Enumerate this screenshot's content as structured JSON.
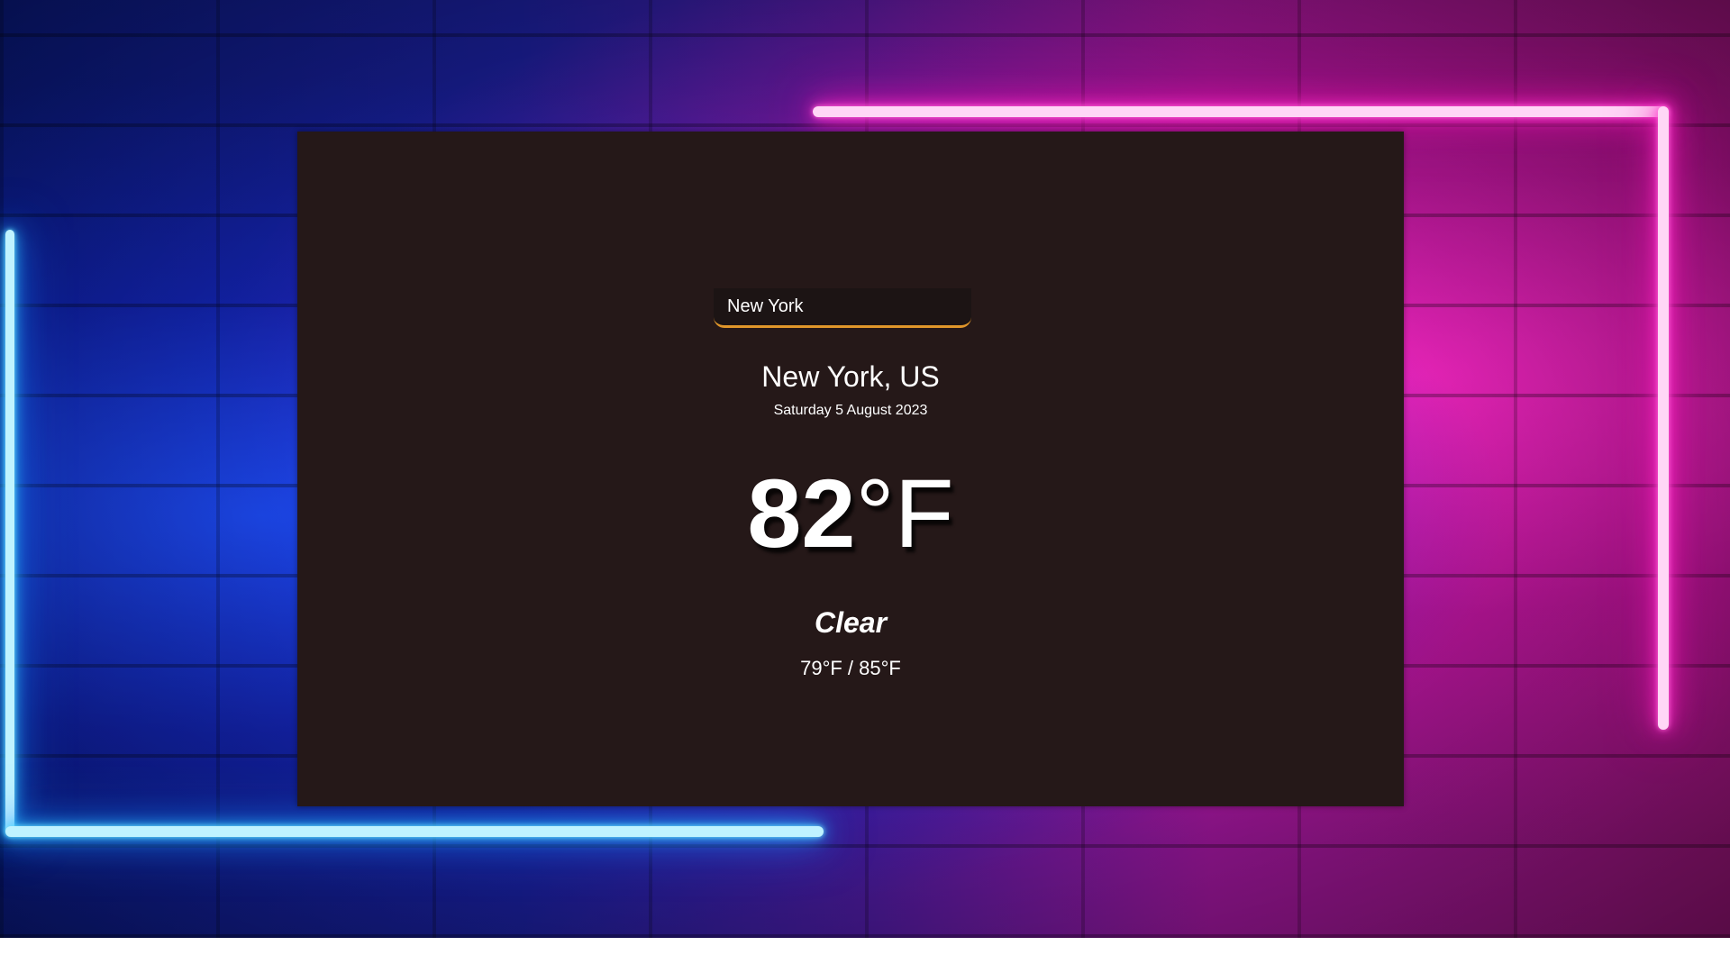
{
  "search": {
    "value": "New York",
    "placeholder": ""
  },
  "weather": {
    "location": "New York, US",
    "date": "Saturday 5 August 2023",
    "temperature_value": "82",
    "temperature_unit": "°F",
    "condition": "Clear",
    "low_high": "79°F / 85°F"
  },
  "colors": {
    "card_background": "#251818",
    "search_accent": "#e0962a",
    "neon_blue": "#2fc3ff",
    "neon_pink": "#ff2fcc",
    "text": "#ffffff"
  }
}
